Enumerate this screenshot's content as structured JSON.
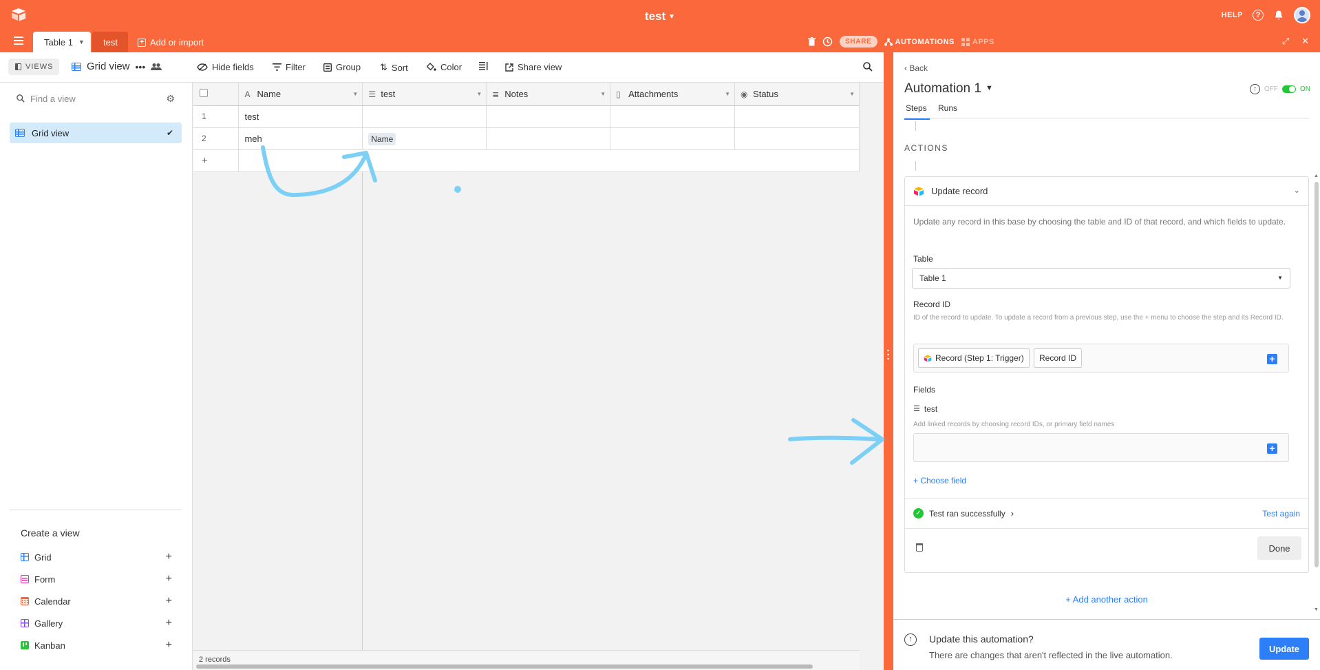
{
  "app": {
    "base_name": "test"
  },
  "top_right": {
    "help_label": "HELP"
  },
  "table_tabs": [
    {
      "label": "Table 1"
    },
    {
      "label": "test"
    }
  ],
  "add_import_label": "Add or import",
  "tab_actions": {
    "share_label": "SHARE",
    "automations_label": "AUTOMATIONS",
    "apps_label": "APPS"
  },
  "toolbar": {
    "views_label": "VIEWS",
    "view_name": "Grid view",
    "hide_fields": "Hide fields",
    "filter": "Filter",
    "group": "Group",
    "sort": "Sort",
    "color": "Color",
    "share_view": "Share view"
  },
  "sidebar": {
    "find_placeholder": "Find a view",
    "active_view": "Grid view",
    "create_title": "Create a view",
    "create_items": [
      {
        "label": "Grid",
        "color": "#2d7ff9"
      },
      {
        "label": "Form",
        "color": "#e929ba"
      },
      {
        "label": "Calendar",
        "color": "#f7653b"
      },
      {
        "label": "Gallery",
        "color": "#8b46ff"
      },
      {
        "label": "Kanban",
        "color": "#20c933"
      }
    ]
  },
  "grid": {
    "columns": [
      "Name",
      "test",
      "Notes",
      "Attachments",
      "Status"
    ],
    "rows": [
      {
        "num": "1",
        "name": "test",
        "test": ""
      },
      {
        "num": "2",
        "name": "meh",
        "test": "Name"
      }
    ],
    "add_row": "+",
    "footer": "2 records"
  },
  "panel": {
    "back": "Back",
    "title": "Automation 1",
    "toggle_off": "OFF",
    "toggle_on": "ON",
    "tabs": [
      "Steps",
      "Runs"
    ],
    "actions_label": "ACTIONS",
    "action_title": "Update record",
    "description": "Update any record in this base by choosing the table and ID of that record, and which fields to update.",
    "table_label": "Table",
    "table_value": "Table 1",
    "record_id_label": "Record ID",
    "record_id_hint": "ID of the record to update. To update a record from a previous step, use the + menu to choose the step and its Record ID.",
    "token_step": "Record (Step 1: Trigger)",
    "token_field": "Record ID",
    "fields_label": "Fields",
    "field_name": "test",
    "field_hint": "Add linked records by choosing record IDs, or primary field names",
    "choose_field": "+ Choose field",
    "test_status": "Test ran successfully",
    "test_again": "Test again",
    "done": "Done",
    "add_action": "+ Add another action"
  },
  "update_bar": {
    "question": "Update this automation?",
    "subtitle": "There are changes that aren't reflected in the live automation.",
    "button": "Update"
  },
  "colors": {
    "brand": "#fa683b",
    "accent": "#2d7ff9",
    "success": "#20c933"
  }
}
